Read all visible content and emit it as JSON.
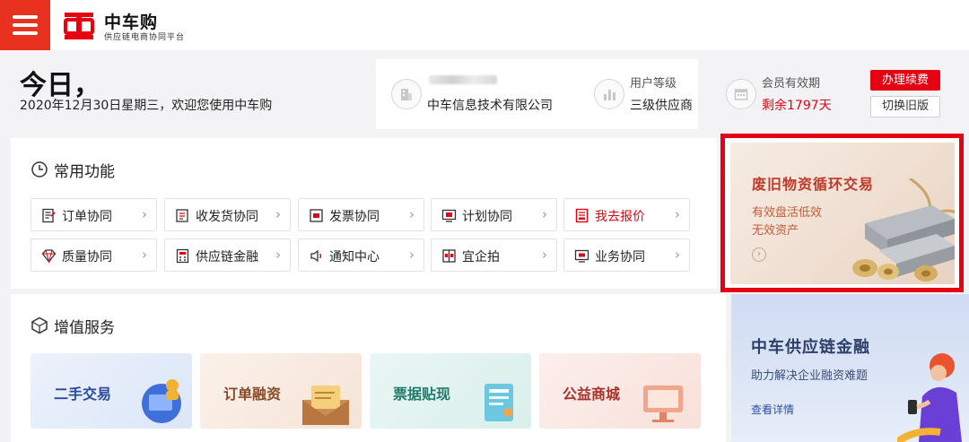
{
  "header": {
    "brand_name": "中车购",
    "brand_subtitle": "供应链电商协同平台"
  },
  "greeting": {
    "title": "今日，",
    "date_line": "2020年12月30日星期三，欢迎您使用中车购"
  },
  "user_card": {
    "company": "中车信息技术有限公司",
    "level_label": "用户等级",
    "level_value": "三级供应商",
    "validity_label": "会员有效期",
    "validity_value": "剩余1797天",
    "renew_button": "办理续费",
    "switch_button": "切换旧版"
  },
  "common_functions": {
    "title": "常用功能",
    "items": [
      {
        "label": "订单协同",
        "icon": "order-doc-icon"
      },
      {
        "label": "收发货协同",
        "icon": "delivery-icon"
      },
      {
        "label": "发票协同",
        "icon": "invoice-icon"
      },
      {
        "label": "计划协同",
        "icon": "plan-icon"
      },
      {
        "label": "我去报价",
        "icon": "quote-icon",
        "highlight": true
      },
      {
        "label": "质量协同",
        "icon": "diamond-icon"
      },
      {
        "label": "供应链金融",
        "icon": "calculator-icon"
      },
      {
        "label": "通知中心",
        "icon": "speaker-icon"
      },
      {
        "label": "宜企拍",
        "icon": "auction-icon"
      },
      {
        "label": "业务协同",
        "icon": "monitor-icon"
      }
    ]
  },
  "banner_recycle": {
    "title": "废旧物资循环交易",
    "line1": "有效盘活低效",
    "line2": "无效资产"
  },
  "value_services": {
    "title": "增值服务",
    "cards": [
      {
        "label": "二手交易",
        "color": "#2b4a9a"
      },
      {
        "label": "订单融资",
        "color": "#8a4a2a"
      },
      {
        "label": "票据贴现",
        "color": "#1f7a6a"
      },
      {
        "label": "公益商城",
        "color": "#a8322a"
      }
    ]
  },
  "banner_finance": {
    "title": "中车供应链金融",
    "subtitle": "助力解决企业融资难题",
    "link": "查看详情"
  },
  "colors": {
    "brand_red": "#e60012",
    "menu_red": "#e8321f"
  }
}
